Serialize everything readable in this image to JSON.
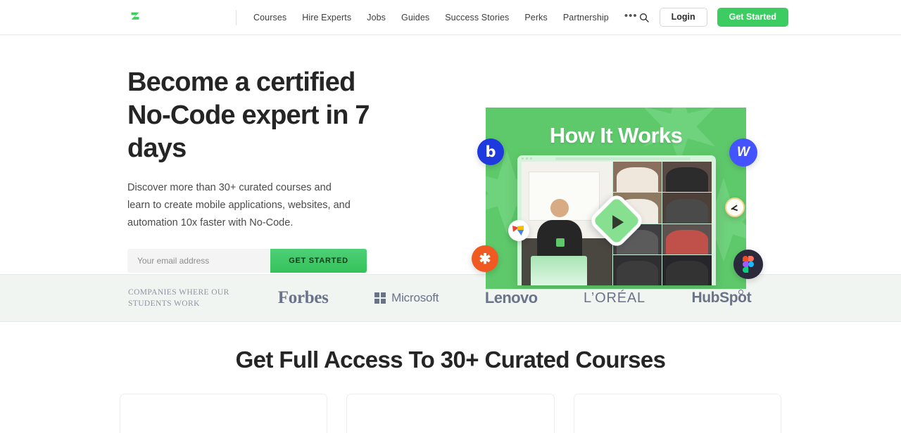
{
  "header": {
    "logo_name": "zerotocode-logo",
    "nav_items": [
      {
        "label": "Courses"
      },
      {
        "label": "Hire Experts"
      },
      {
        "label": "Jobs"
      },
      {
        "label": "Guides"
      },
      {
        "label": "Success Stories"
      },
      {
        "label": "Perks"
      },
      {
        "label": "Partnership"
      }
    ],
    "more_label": "•••",
    "search_icon": "search-icon",
    "login_label": "Login",
    "get_started_label": "Get Started",
    "accent_color": "#3ccc62"
  },
  "hero": {
    "title": "Become a certified No-Code expert in 7 days",
    "subtitle": "Discover more than 30+ curated courses and learn to create mobile applications, websites, and automation 10x faster with No-Code.",
    "email_placeholder": "Your email address",
    "email_value": "",
    "submit_label": "GET STARTED",
    "media": {
      "caption": "How It Works",
      "play_icon": "play-icon",
      "background_color": "#5ec96b",
      "floating_icons": [
        {
          "name": "bubble-icon",
          "glyph": "b",
          "color": "#1e39dd"
        },
        {
          "name": "webflow-icon",
          "glyph": "W",
          "color": "#4353ff"
        },
        {
          "name": "zapier-icon",
          "glyph": "✱",
          "color": "#f05a22"
        },
        {
          "name": "figma-icon",
          "glyph": "",
          "color": "#2a2a3c"
        },
        {
          "name": "glide-icon",
          "glyph": "",
          "color": "#ffffff"
        },
        {
          "name": "airtable-icon",
          "glyph": "",
          "color": "#fdfdf7"
        }
      ]
    }
  },
  "logo_band": {
    "label": "COMPANIES WHERE OUR STUDENTS WORK",
    "brands": [
      {
        "name": "forbes",
        "label": "Forbes"
      },
      {
        "name": "microsoft",
        "label": "Microsoft"
      },
      {
        "name": "lenovo",
        "label": "Lenovo"
      },
      {
        "name": "loreal",
        "label": "L’ORÉAL"
      },
      {
        "name": "hubspot",
        "label": "HubSpot"
      }
    ],
    "background_color": "#f1f5f1"
  },
  "section": {
    "title": "Get Full Access To 30+ Curated Courses",
    "cards": [
      {
        "name": "course-card-1"
      },
      {
        "name": "course-card-2"
      },
      {
        "name": "course-card-3"
      }
    ]
  }
}
